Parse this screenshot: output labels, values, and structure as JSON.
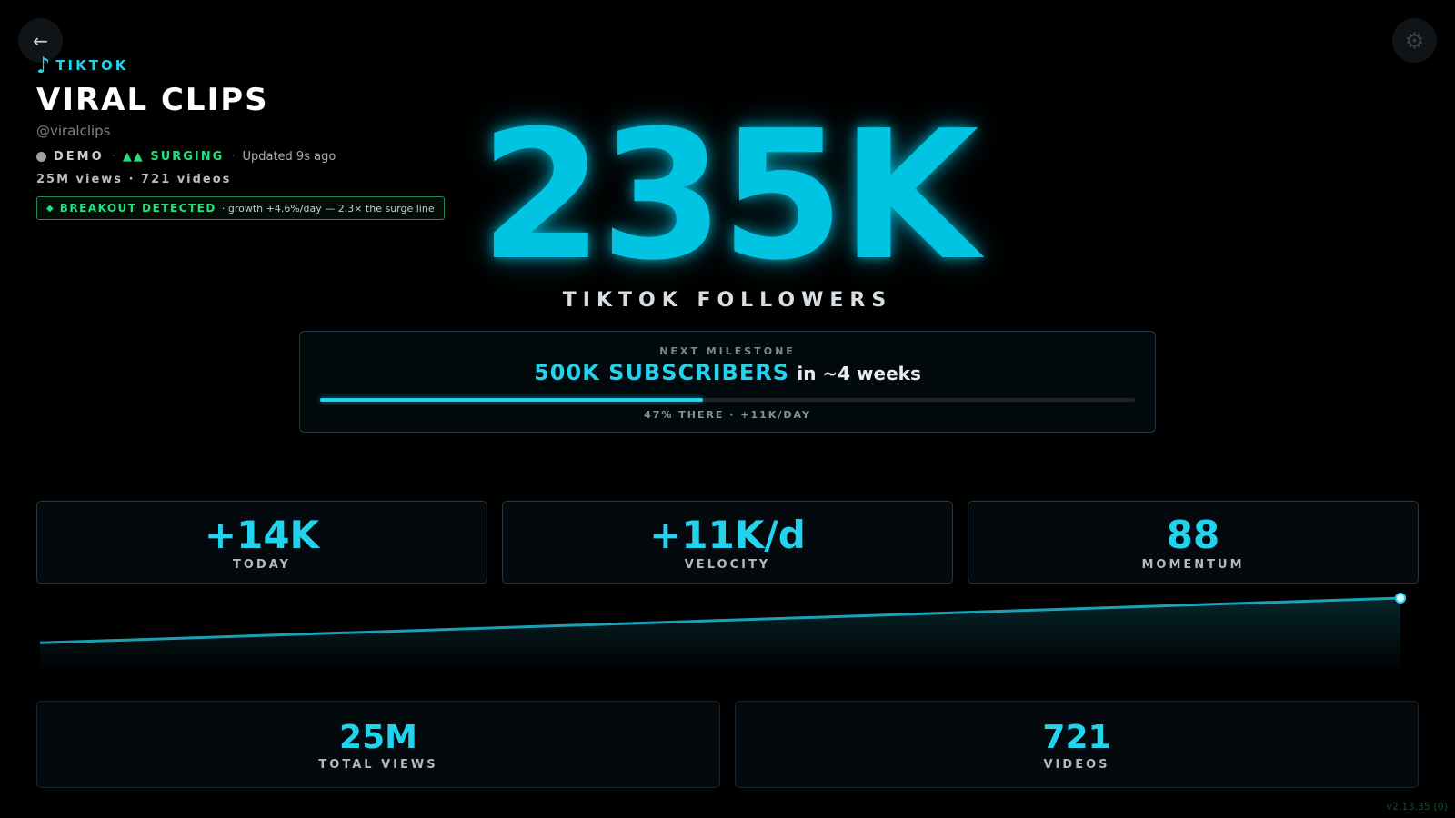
{
  "nav": {
    "back_icon": "←",
    "settings_icon": "⚙"
  },
  "header": {
    "platform": "TIKTOK",
    "platform_icon": "♪",
    "title": "VIRAL CLIPS",
    "handle": "@viralclips",
    "status": {
      "mode": "DEMO",
      "trend": "▲▲ SURGING",
      "updated": "Updated 9s ago"
    },
    "stats_line": "25M views · 721 videos",
    "breakout": {
      "icon": "◆",
      "label": "BREAKOUT DETECTED",
      "detail": "· growth +4.6%/day — 2.3× the surge line"
    }
  },
  "hero": {
    "value": "235K",
    "label": "TIKTOK FOLLOWERS"
  },
  "milestone": {
    "kicker": "NEXT MILESTONE",
    "target": "500K SUBSCRIBERS",
    "eta": "in ~4 weeks",
    "progress": 0.47,
    "subtext": "47% THERE · +11K/DAY"
  },
  "metrics": [
    {
      "value": "+14K",
      "label": "TODAY"
    },
    {
      "value": "+11K/d",
      "label": "VELOCITY"
    },
    {
      "value": "88",
      "label": "MOMENTUM"
    }
  ],
  "totals": [
    {
      "value": "25M",
      "label": "TOTAL VIEWS"
    },
    {
      "value": "721",
      "label": "VIDEOS"
    }
  ],
  "trend_chart": {
    "type": "area",
    "x": [
      0,
      1
    ],
    "y": [
      0.15,
      1.0
    ],
    "color": "#22d3ee"
  },
  "version": "v2.13.35 (0)",
  "colors": {
    "accent": "#22d3ee",
    "success": "#22e07a",
    "background": "#000000"
  }
}
